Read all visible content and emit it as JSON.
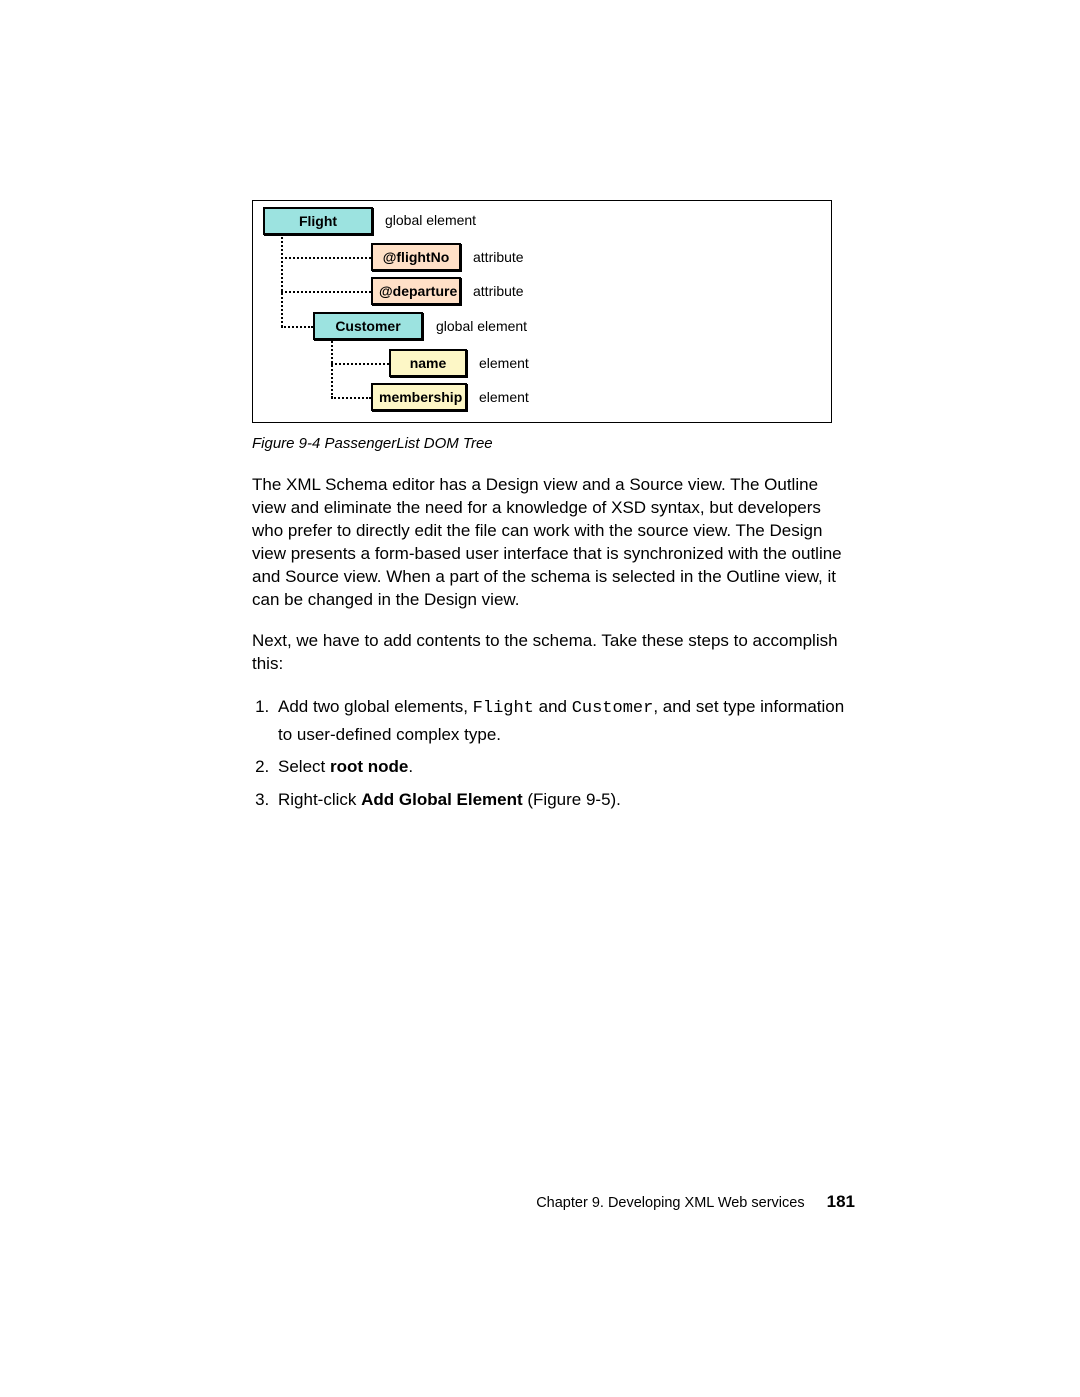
{
  "diagram": {
    "nodes": {
      "flight": {
        "label": "Flight",
        "desc": "global element"
      },
      "flightNo": {
        "label": "@flightNo",
        "desc": "attribute"
      },
      "departure": {
        "label": "@departure",
        "desc": "attribute"
      },
      "customer": {
        "label": "Customer",
        "desc": "global element"
      },
      "name": {
        "label": "name",
        "desc": "element"
      },
      "membership": {
        "label": "membership",
        "desc": "element"
      }
    }
  },
  "caption": "Figure 9-4   PassengerList DOM Tree",
  "paragraphs": {
    "p1": "The XML Schema editor has a Design view and a Source view. The Outline view and eliminate the need for a knowledge of XSD syntax, but developers who prefer to directly edit the file can work with the source view. The Design view presents a form-based user interface that is synchronized with the outline and Source view. When a part of the schema is selected in the Outline view, it can be changed in the Design view.",
    "p2": "Next, we have to add contents to the schema. Take these steps to accomplish this:"
  },
  "steps": {
    "s1_a": "Add two global elements, ",
    "s1_code1": "Flight",
    "s1_b": " and ",
    "s1_code2": "Customer",
    "s1_c": ", and set type information to user-defined complex type.",
    "s2_a": "Select ",
    "s2_bold": "root node",
    "s2_b": ".",
    "s3_a": "Right-click ",
    "s3_bold": "Add Global Element",
    "s3_b": " (Figure 9-5)."
  },
  "footer": {
    "text": "Chapter 9. Developing XML Web services",
    "page": "181"
  }
}
